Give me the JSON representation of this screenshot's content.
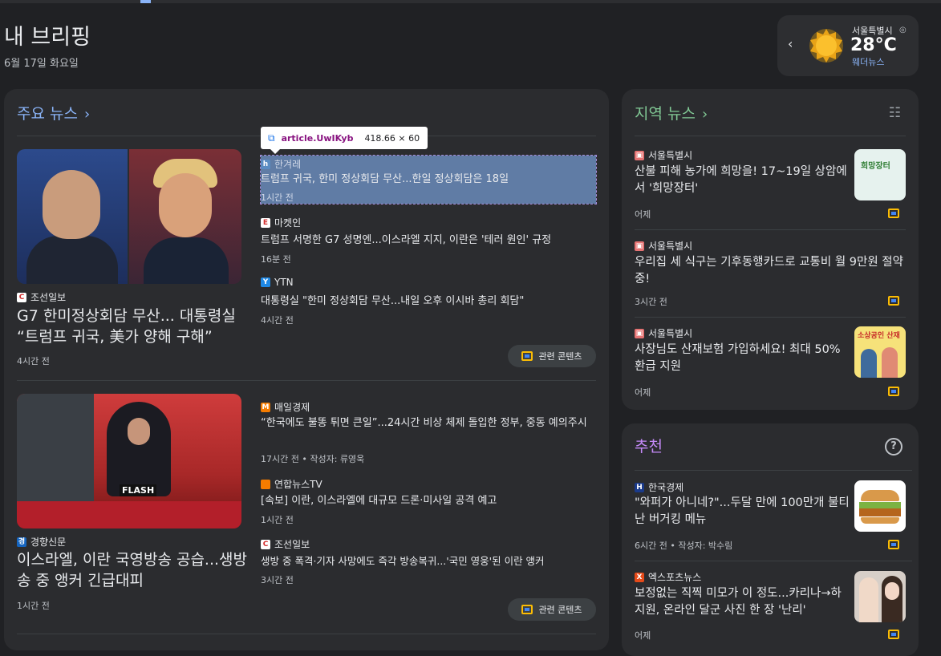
{
  "header": {
    "title": "내 브리핑",
    "date": "6월 17일 화요일"
  },
  "weather": {
    "city": "서울특별시",
    "temp": "28°C",
    "source": "웨더뉴스",
    "icon": "sun-icon"
  },
  "top_news": {
    "heading": "주요 뉴스",
    "tooltip": {
      "name": "article.UwIKyb",
      "size": "418.66 × 60"
    },
    "related_label": "관련 콘텐츠",
    "clusters": [
      {
        "main": {
          "source": "조선일보",
          "headline": "G7 한미정상회담 무산... 대통령실 “트럼프 귀국, 美가 양해 구해”",
          "time": "4시간 전"
        },
        "articles": [
          {
            "source": "한겨레",
            "headline": "트럼프 귀국, 한미 정상회담 무산...한일 정상회담은 18일",
            "meta": "1시간 전"
          },
          {
            "source": "마켓인",
            "headline": "트럼프 서명한 G7 성명엔...이스라엘 지지, 이란은 '테러 원인' 규정",
            "meta": "16분 전"
          },
          {
            "source": "YTN",
            "headline": "대통령실 \"한미 정상회담 무산...내일 오후 이시바 총리 회담\"",
            "meta": "4시간 전"
          }
        ]
      },
      {
        "main": {
          "source": "경향신문",
          "headline": "이스라엘, 이란 국영방송 공습...생방송 중 앵커 긴급대피",
          "time": "1시간 전"
        },
        "articles": [
          {
            "source": "매일경제",
            "headline": "“한국에도 불똥 튀면 큰일”...24시간 비상 체제 돌입한 정부, 중동 예의주시",
            "meta": "17시간 전 • 작성자: 류영욱"
          },
          {
            "source": "연합뉴스TV",
            "headline": "[속보] 이란, 이스라엘에 대규모 드론·미사일 공격 예고",
            "meta": "1시간 전"
          },
          {
            "source": "조선일보",
            "headline": "생방 중 폭격·기자 사망에도 즉각 방송복귀...'국민 영웅'된 이란 앵커",
            "meta": "3시간 전"
          }
        ]
      }
    ]
  },
  "local_news": {
    "heading": "지역 뉴스",
    "items": [
      {
        "source": "서울특별시",
        "headline": "산불 피해 농가에 희망을! 17~19일 상암에서 '희망장터'",
        "time": "어제"
      },
      {
        "source": "서울특별시",
        "headline": "우리집 세 식구는 기후동행카드로 교통비 월 9만원 절약 중!",
        "time": "3시간 전"
      },
      {
        "source": "서울특별시",
        "headline": "사장님도 산재보험 가입하세요! 최대 50% 환급 지원",
        "time": "어제"
      }
    ]
  },
  "recommended": {
    "heading": "추천",
    "items": [
      {
        "source": "한국경제",
        "headline": "\"와퍼가 아니네?\"...두달 만에 100만개 불티난 버거킹 메뉴",
        "meta": "6시간 전 • 작성자: 박수림"
      },
      {
        "source": "엑스포츠뉴스",
        "headline": "보정없는 직찍 미모가 이 정도...카리나→하지원, 온라인 달군 사진 한 장 '난리'",
        "meta": "어제"
      }
    ]
  },
  "thumb_texts": {
    "local1": "희망장터",
    "local3": "소상공인 산재"
  }
}
